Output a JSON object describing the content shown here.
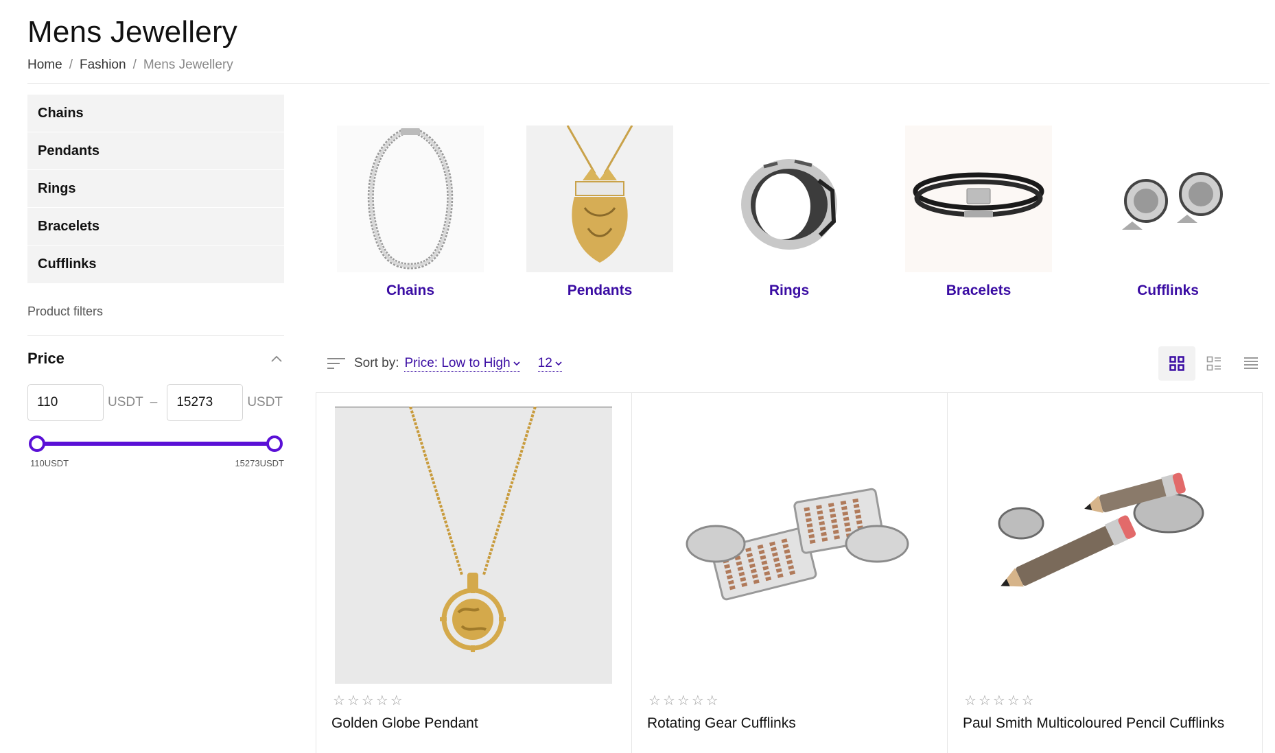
{
  "page": {
    "title": "Mens Jewellery"
  },
  "breadcrumb": {
    "items": [
      "Home",
      "Fashion",
      "Mens Jewellery"
    ],
    "separator": "/"
  },
  "sidebar": {
    "categories": [
      "Chains",
      "Pendants",
      "Rings",
      "Bracelets",
      "Cufflinks"
    ],
    "filters_title": "Product filters",
    "price": {
      "label": "Price",
      "min_value": "110",
      "max_value": "15273",
      "unit": "USDT",
      "dash": "–",
      "min_label": "110USDT",
      "max_label": "15273USDT"
    }
  },
  "category_tiles": [
    {
      "label": "Chains",
      "icon": "silver-chain-image"
    },
    {
      "label": "Pendants",
      "icon": "gold-lion-pendant-image"
    },
    {
      "label": "Rings",
      "icon": "silver-ring-image"
    },
    {
      "label": "Bracelets",
      "icon": "leather-bracelet-image"
    },
    {
      "label": "Cufflinks",
      "icon": "silver-cufflinks-image"
    }
  ],
  "toolbar": {
    "sort_label": "Sort by:",
    "sort_value": "Price: Low to High",
    "per_page": "12",
    "views": [
      "grid-view",
      "grid-list-view",
      "list-view"
    ],
    "active_view": "grid-view"
  },
  "products": [
    {
      "name": "Golden Globe Pendant",
      "rating": 0,
      "icon": "gold-globe-pendant-image"
    },
    {
      "name": "Rotating Gear Cufflinks",
      "rating": 0,
      "icon": "gear-cufflinks-image"
    },
    {
      "name": "Paul Smith Multicoloured Pencil Cufflinks",
      "rating": 0,
      "icon": "pencil-cufflinks-image"
    }
  ],
  "colors": {
    "accent": "#5a10d6",
    "link": "#3a0ca3",
    "sidebar_bg": "#f3f3f3"
  }
}
